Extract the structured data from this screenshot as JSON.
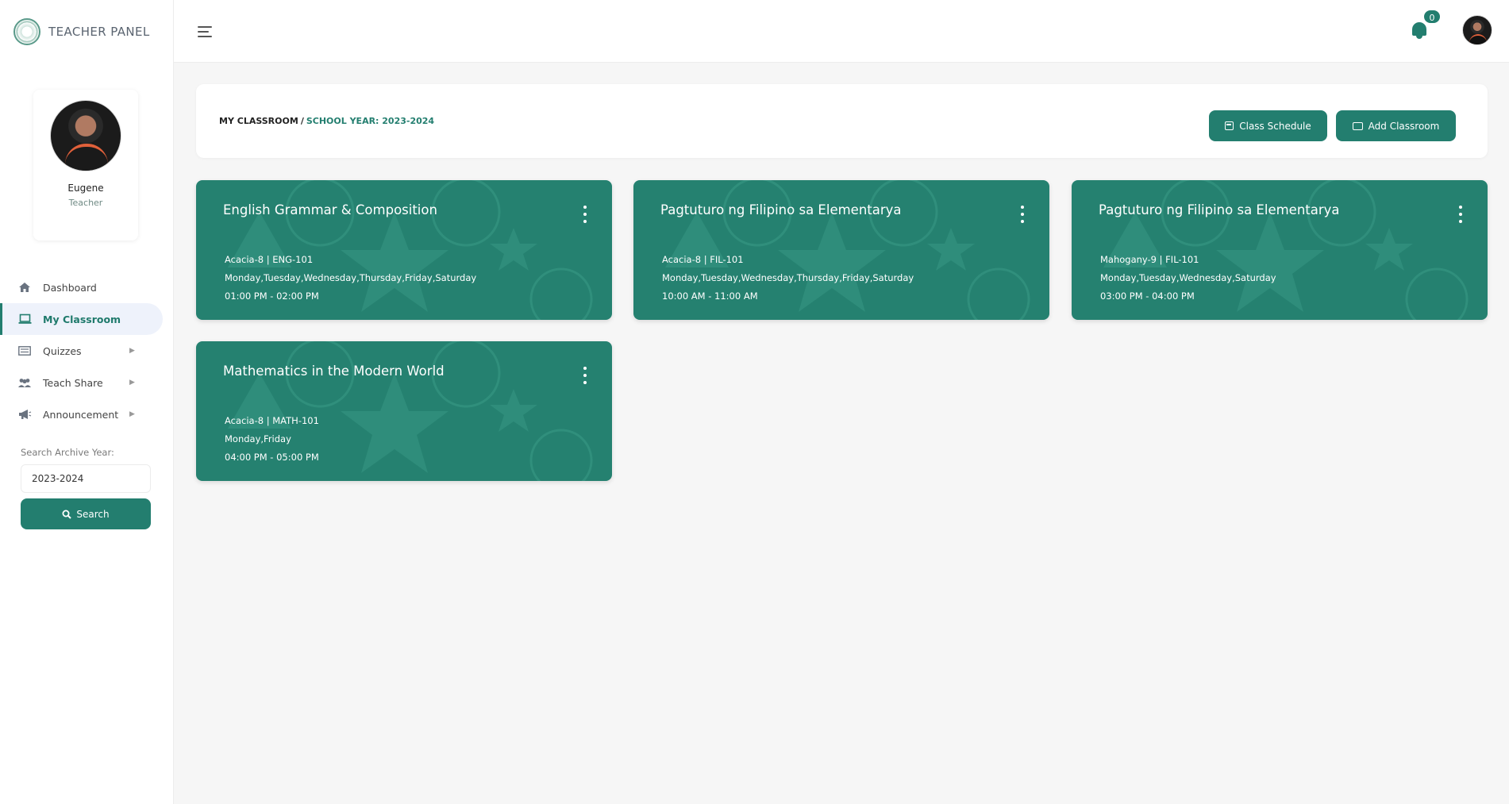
{
  "brand": {
    "title": "TEACHER PANEL"
  },
  "profile": {
    "name": "Eugene",
    "role": "Teacher"
  },
  "nav": {
    "items": [
      {
        "label": "Dashboard",
        "icon": "home-icon"
      },
      {
        "label": "My Classroom",
        "icon": "laptop-icon",
        "active": true
      },
      {
        "label": "Quizzes",
        "icon": "list-icon",
        "has_submenu": true
      },
      {
        "label": "Teach Share",
        "icon": "people-icon",
        "has_submenu": true
      },
      {
        "label": "Announcement",
        "icon": "megaphone-icon",
        "has_submenu": true
      }
    ]
  },
  "archive": {
    "label": "Search Archive Year:",
    "value": "2023-2024",
    "search_label": "Search"
  },
  "topbar": {
    "notification_count": "0"
  },
  "header": {
    "crumb_main": "MY CLASSROOM",
    "crumb_sep": "/",
    "crumb_year": "SCHOOL YEAR: 2023-2024",
    "schedule_label": "Class Schedule",
    "add_label": "Add Classroom"
  },
  "classes": [
    {
      "title": "English Grammar & Composition",
      "section_code": "Acacia-8 | ENG-101",
      "days": "Monday,Tuesday,Wednesday,Thursday,Friday,Saturday",
      "time": "01:00 PM - 02:00 PM"
    },
    {
      "title": "Pagtuturo ng Filipino sa Elementarya",
      "section_code": "Acacia-8 | FIL-101",
      "days": "Monday,Tuesday,Wednesday,Thursday,Friday,Saturday",
      "time": "10:00 AM - 11:00 AM"
    },
    {
      "title": "Pagtuturo ng Filipino sa Elementarya",
      "section_code": "Mahogany-9 | FIL-101",
      "days": "Monday,Tuesday,Wednesday,Saturday",
      "time": "03:00 PM - 04:00 PM"
    },
    {
      "title": "Mathematics in the Modern World",
      "section_code": "Acacia-8 | MATH-101",
      "days": "Monday,Friday",
      "time": "04:00 PM - 05:00 PM"
    }
  ],
  "colors": {
    "accent": "#237e6f",
    "card": "#258170",
    "page_bg": "#f6f6f6"
  }
}
